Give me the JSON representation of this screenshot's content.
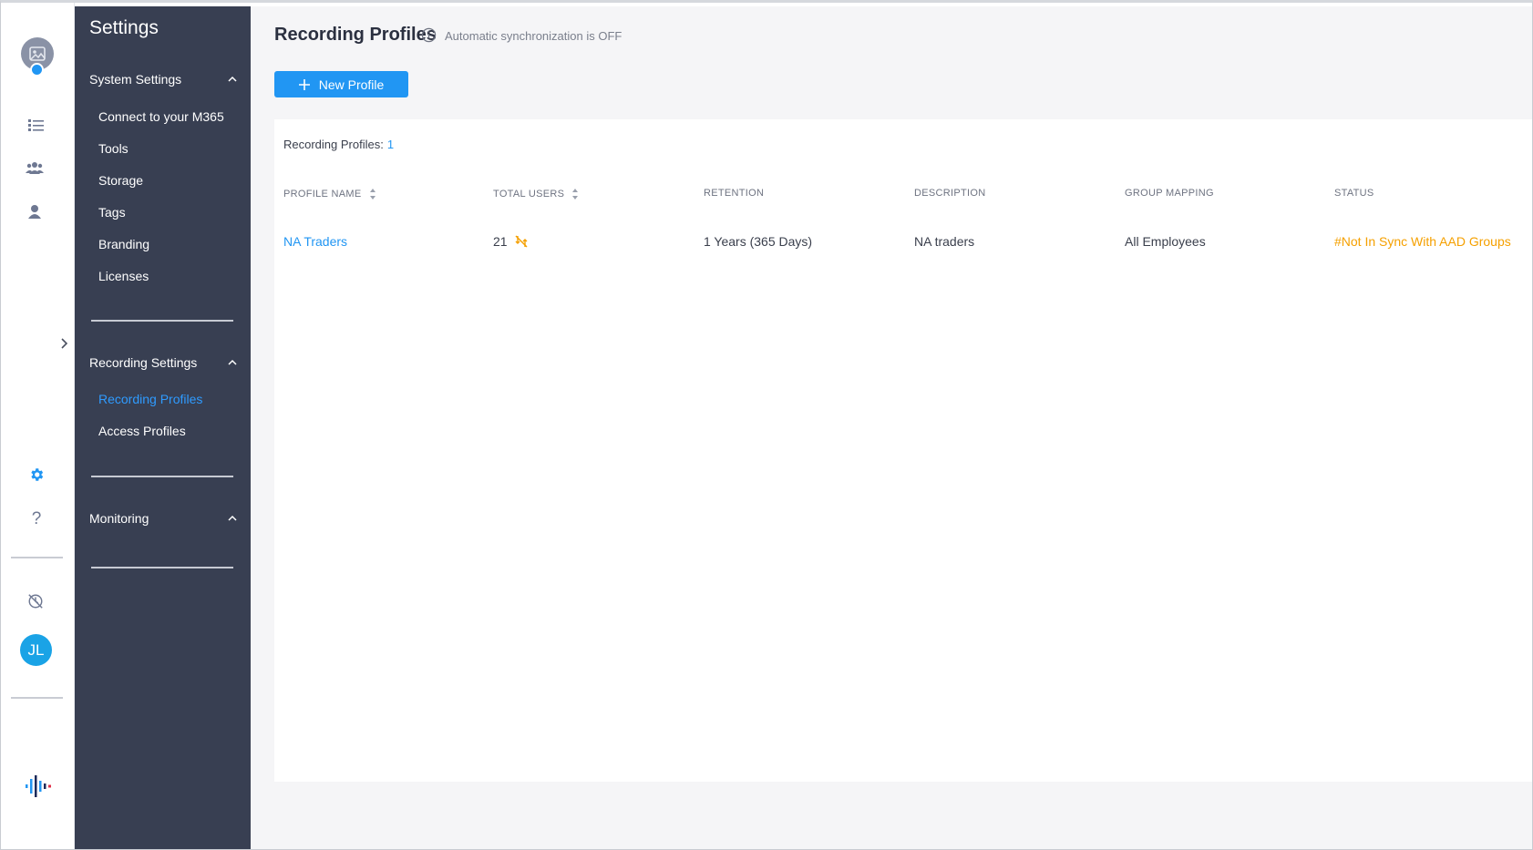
{
  "colors": {
    "accent": "#2196f3",
    "sidebar_bg": "#383f52",
    "status_warning": "#f5a000"
  },
  "rail": {
    "icons": [
      "photo-avatar-icon",
      "list-icon",
      "group-icon",
      "user-icon",
      "expand-chevron-icon",
      "gear-icon",
      "help-icon",
      "history-icon",
      "logo-icon"
    ],
    "user_initials": "JL",
    "help_glyph": "?"
  },
  "sidebar": {
    "title": "Settings",
    "groups": [
      {
        "label": "System Settings",
        "items": [
          {
            "label": "Connect to your M365"
          },
          {
            "label": "Tools"
          },
          {
            "label": "Storage"
          },
          {
            "label": "Tags"
          },
          {
            "label": "Branding"
          },
          {
            "label": "Licenses"
          }
        ]
      },
      {
        "label": "Recording Settings",
        "items": [
          {
            "label": "Recording Profiles",
            "active": true
          },
          {
            "label": "Access Profiles"
          }
        ]
      },
      {
        "label": "Monitoring",
        "items": []
      }
    ]
  },
  "main": {
    "title": "Recording Profiles",
    "sync_status": "Automatic synchronization is OFF",
    "new_button_label": "New Profile",
    "count_label": "Recording Profiles:",
    "count_value": "1",
    "table": {
      "columns": [
        "PROFILE NAME",
        "TOTAL USERS",
        "RETENTION",
        "DESCRIPTION",
        "GROUP MAPPING",
        "STATUS"
      ],
      "rows": [
        {
          "profile_name": "NA Traders",
          "total_users": "21",
          "retention": "1 Years (365 Days)",
          "description": "NA traders",
          "group_mapping": "All Employees",
          "status": "#Not In Sync With AAD Groups"
        }
      ]
    }
  }
}
